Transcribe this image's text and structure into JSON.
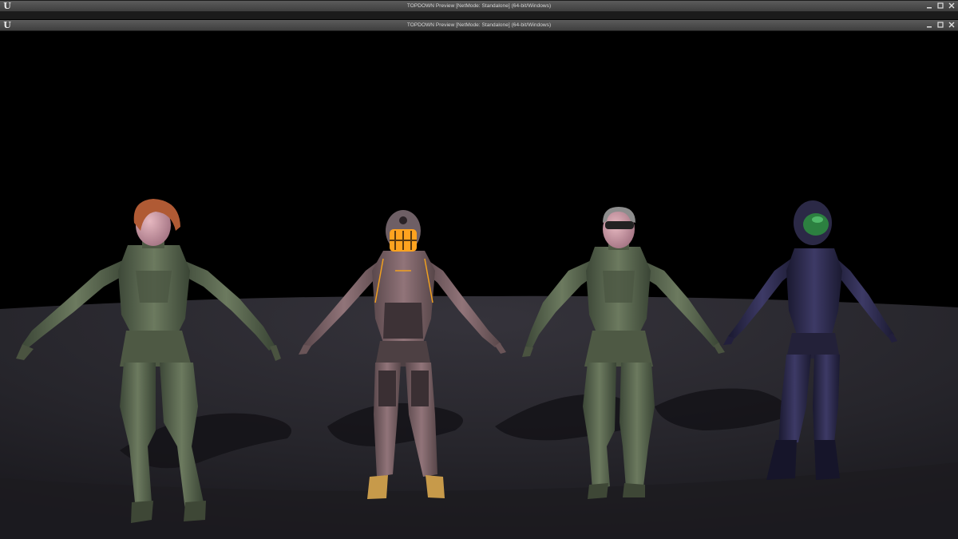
{
  "windows": [
    {
      "title": "TOPDOWN Preview [NetMode: Standalone] (64-bit/Windows)",
      "logo": "U",
      "controls": [
        "minimize-icon",
        "maximize-icon",
        "close-icon"
      ]
    },
    {
      "title": "TOPDOWN Preview [NetMode: Standalone] (64-bit/Windows)",
      "logo": "U",
      "controls": [
        "minimize-icon",
        "maximize-icon",
        "close-icon"
      ]
    }
  ],
  "scene": {
    "background": "#000000",
    "floor_color": "#2b2a30",
    "characters": [
      {
        "name": "red-haired-armored-soldier",
        "armor": "#5d6b52",
        "skin": "#c9a0a6",
        "hair": "#b35a32"
      },
      {
        "name": "masked-orange-light-suit",
        "armor": "#7a6568",
        "accent": "#f0a020",
        "visor": "#ffa31f"
      },
      {
        "name": "goggled-armored-soldier",
        "armor": "#5f6b53",
        "skin": "#d0a0a8",
        "goggles": "#222222"
      },
      {
        "name": "helmeted-blue-bodysuit",
        "armor": "#2c2a4c",
        "visor": "#2c8040"
      }
    ]
  }
}
